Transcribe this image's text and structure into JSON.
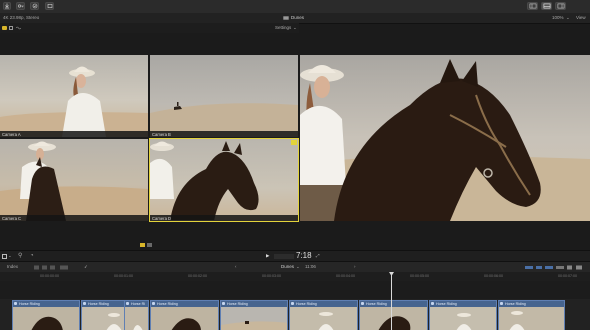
{
  "toolbar": {
    "left_buttons": [
      "import-icon",
      "key-icon",
      "check-icon",
      "share-icon"
    ],
    "right_buttons": [
      "browser-layout-icon",
      "timeline-layout-icon",
      "inspector-layout-icon"
    ]
  },
  "viewer_header": {
    "format": "4K 23.98p, Stereo",
    "project_name": "Dunes",
    "zoom": "100%",
    "view_menu": "View"
  },
  "angle_viewer": {
    "settings_label": "Settings",
    "angles": [
      {
        "label": "Camera A"
      },
      {
        "label": "Camera B"
      },
      {
        "label": "Camera C"
      },
      {
        "label": "Camera D"
      }
    ]
  },
  "playback": {
    "timecode": "7:18"
  },
  "timeline_header": {
    "index_label": "Index",
    "project": "Dunes",
    "duration": "11:06"
  },
  "ruler": {
    "ticks": [
      "00:00:00:00",
      "00:00:01:00",
      "00:00:02:00",
      "00:00:03:00",
      "00:00:04:00",
      "00:00:05:00",
      "00:00:06:00",
      "00:00:07:00"
    ]
  },
  "clips": [
    {
      "name": "Horse Riding"
    },
    {
      "name": "Horse Riding"
    },
    {
      "name": "Horse Ri"
    },
    {
      "name": "Horse Riding"
    },
    {
      "name": "Horse Riding"
    },
    {
      "name": "Horse Riding"
    },
    {
      "name": "Horse Riding"
    },
    {
      "name": "Horse Riding"
    },
    {
      "name": "Horse Riding"
    }
  ]
}
